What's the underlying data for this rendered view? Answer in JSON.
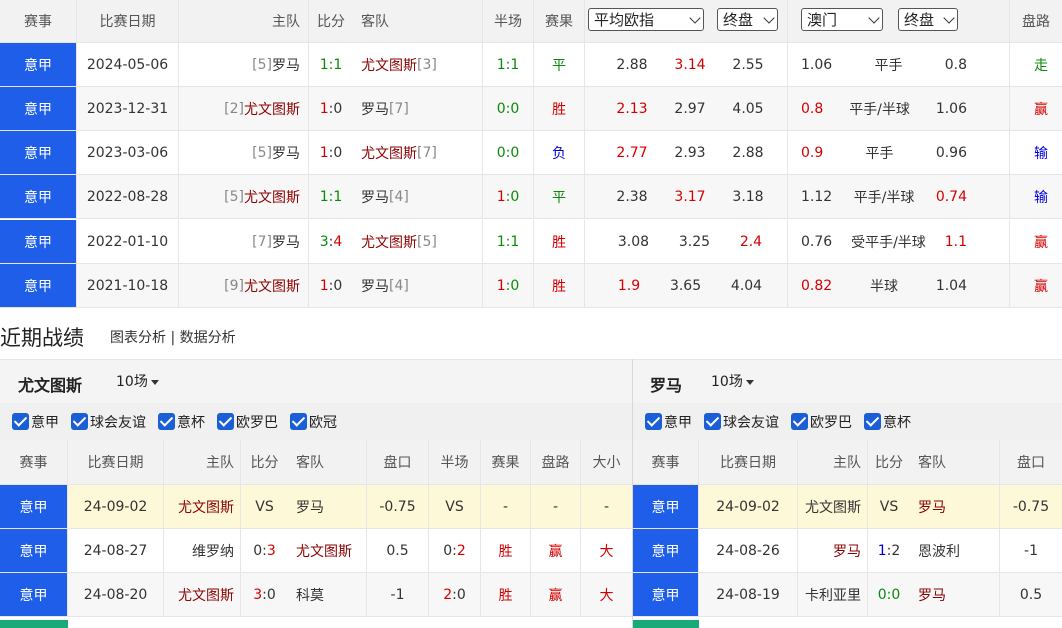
{
  "h2h_header": {
    "league": "赛事",
    "date": "比赛日期",
    "home": "主队",
    "score": "比分",
    "away": "客队",
    "half": "半场",
    "result": "赛果",
    "odds_select": "平均欧指",
    "odds_type": "终盘",
    "company": "澳门",
    "company_type": "终盘",
    "road": "盘路"
  },
  "h2h_rows": [
    {
      "league": "意甲",
      "date": "2024-05-06",
      "home_rank": "[5]",
      "home": "罗马",
      "s1": "1",
      "s2": "1",
      "away": "尤文图斯",
      "away_rank": "[3]",
      "h1": "1",
      "h2": "1",
      "result": "平",
      "o1": "2.88",
      "o2": "3.14",
      "o3": "2.55",
      "a1": "1.06",
      "hc": "平手",
      "a2": "0.8",
      "road": "走"
    },
    {
      "league": "意甲",
      "date": "2023-12-31",
      "home_rank": "[2]",
      "home": "尤文图斯",
      "s1": "1",
      "s2": "0",
      "away": "罗马",
      "away_rank": "[7]",
      "h1": "0",
      "h2": "0",
      "result": "胜",
      "o1": "2.13",
      "o2": "2.97",
      "o3": "4.05",
      "a1": "0.8",
      "hc": "平手/半球",
      "a2": "1.06",
      "road": "赢"
    },
    {
      "league": "意甲",
      "date": "2023-03-06",
      "home_rank": "[5]",
      "home": "罗马",
      "s1": "1",
      "s2": "0",
      "away": "尤文图斯",
      "away_rank": "[7]",
      "h1": "0",
      "h2": "0",
      "result": "负",
      "o1": "2.77",
      "o2": "2.93",
      "o3": "2.88",
      "a1": "0.9",
      "hc": "平手",
      "a2": "0.96",
      "road": "输"
    },
    {
      "league": "意甲",
      "date": "2022-08-28",
      "home_rank": "[5]",
      "home": "尤文图斯",
      "s1": "1",
      "s2": "1",
      "away": "罗马",
      "away_rank": "[4]",
      "h1": "1",
      "h2": "0",
      "result": "平",
      "o1": "2.38",
      "o2": "3.17",
      "o3": "3.18",
      "a1": "1.12",
      "hc": "平手/半球",
      "a2": "0.74",
      "road": "输"
    },
    {
      "league": "意甲",
      "date": "2022-01-10",
      "home_rank": "[7]",
      "home": "罗马",
      "s1": "3",
      "s2": "4",
      "away": "尤文图斯",
      "away_rank": "[5]",
      "h1": "1",
      "h2": "1",
      "result": "胜",
      "o1": "3.08",
      "o2": "3.25",
      "o3": "2.4",
      "a1": "0.76",
      "hc": "受平手/半球",
      "a2": "1.1",
      "road": "赢"
    },
    {
      "league": "意甲",
      "date": "2021-10-18",
      "home_rank": "[9]",
      "home": "尤文图斯",
      "s1": "1",
      "s2": "0",
      "away": "罗马",
      "away_rank": "[4]",
      "h1": "1",
      "h2": "0",
      "result": "胜",
      "o1": "1.9",
      "o2": "3.65",
      "o3": "4.04",
      "a1": "0.82",
      "hc": "半球",
      "a2": "1.04",
      "road": "赢"
    }
  ],
  "recent": {
    "title": "近期战绩",
    "links": "图表分析 | 数据分析",
    "left_team": "尤文图斯",
    "left_count": "10场",
    "right_team": "罗马",
    "right_count": "10场",
    "left_filters": [
      "意甲",
      "球会友谊",
      "意杯",
      "欧罗巴",
      "欧冠"
    ],
    "right_filters": [
      "意甲",
      "球会友谊",
      "欧罗巴",
      "意杯"
    ],
    "headers": {
      "league": "赛事",
      "date": "比赛日期",
      "home": "主队",
      "score": "比分",
      "away": "客队",
      "handicap": "盘口",
      "half": "半场",
      "result": "赛果",
      "road": "盘路",
      "ou": "大小"
    },
    "left_rows": [
      {
        "league": "意甲",
        "date": "24-09-02",
        "home": "尤文图斯",
        "s1": "VS",
        "s2": "",
        "away": "罗马",
        "hc": "-0.75",
        "half": "VS",
        "h2": "",
        "result": "-",
        "road": "-",
        "ou": "-"
      },
      {
        "league": "意甲",
        "date": "24-08-27",
        "home": "维罗纳",
        "s1": "0",
        "s2": "3",
        "away": "尤文图斯",
        "hc": "0.5",
        "half": "0",
        "h2": "2",
        "result": "胜",
        "road": "赢",
        "ou": "大"
      },
      {
        "league": "意甲",
        "date": "24-08-20",
        "home": "尤文图斯",
        "s1": "3",
        "s2": "0",
        "away": "科莫",
        "hc": "-1",
        "half": "2",
        "h2": "0",
        "result": "胜",
        "road": "赢",
        "ou": "大"
      }
    ],
    "right_rows": [
      {
        "league": "意甲",
        "date": "24-09-02",
        "home": "尤文图斯",
        "s1": "VS",
        "s2": "",
        "away": "罗马",
        "hc": "-0.75"
      },
      {
        "league": "意甲",
        "date": "24-08-26",
        "home": "罗马",
        "s1": "1",
        "s2": "2",
        "away": "恩波利",
        "hc": "-1"
      },
      {
        "league": "意甲",
        "date": "24-08-19",
        "home": "卡利亚里",
        "s1": "0",
        "s2": "0",
        "away": "罗马",
        "hc": "0.5"
      }
    ]
  }
}
